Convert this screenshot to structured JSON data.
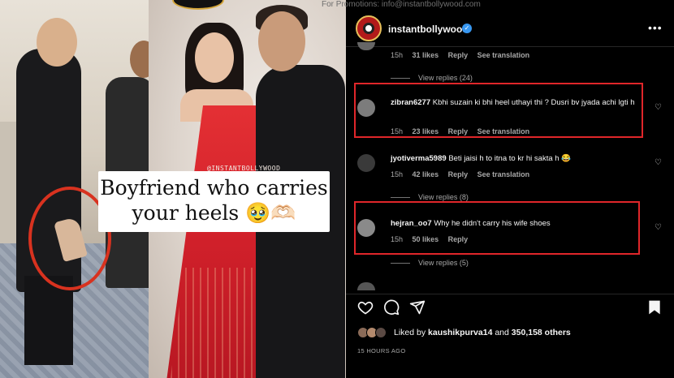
{
  "promo_text": "For Promotions: info@instantbollywood.com",
  "post": {
    "caption_line1": "Boyfriend who carries",
    "caption_line2": "your heels 🥹🫶🏻",
    "watermark": "@INSTANTBOLLYWOOD"
  },
  "header": {
    "username": "instantbollywood",
    "verified_icon": "verified-badge-icon",
    "more_icon": "•••"
  },
  "comments": [
    {
      "username": "",
      "text": "",
      "meta": {
        "time": "15h",
        "likes": "31 likes",
        "reply": "Reply",
        "translate": "See translation"
      },
      "view_replies": "View replies (24)"
    },
    {
      "username": "zibran6277",
      "text": "Kbhi suzain ki bhi heel uthayi thi ? Dusri bv jyada achi lgti h",
      "meta": {
        "time": "15h",
        "likes": "23 likes",
        "reply": "Reply",
        "translate": "See translation"
      },
      "highlighted": true
    },
    {
      "username": "jyotiverma5989",
      "text": "Beti jaisi h to itna to kr hi sakta h 😂",
      "meta": {
        "time": "15h",
        "likes": "42 likes",
        "reply": "Reply",
        "translate": "See translation"
      },
      "view_replies": "View replies (8)"
    },
    {
      "username": "hejran_oo7",
      "text": "Why he didn't carry his wife shoes",
      "meta": {
        "time": "15h",
        "likes": "50 likes",
        "reply": "Reply"
      },
      "view_replies": "View replies (5)",
      "highlighted": true
    }
  ],
  "actions": {
    "like_icon": "heart-icon",
    "comment_icon": "comment-icon",
    "share_icon": "share-icon",
    "save_icon": "bookmark-icon"
  },
  "likes": {
    "prefix": "Liked by",
    "user": "kaushikpurva14",
    "connector": "and",
    "count": "350,158 others"
  },
  "timestamp": "15 HOURS AGO",
  "colors": {
    "highlight": "#e0262a",
    "verified": "#3897f0",
    "background": "#000000"
  }
}
